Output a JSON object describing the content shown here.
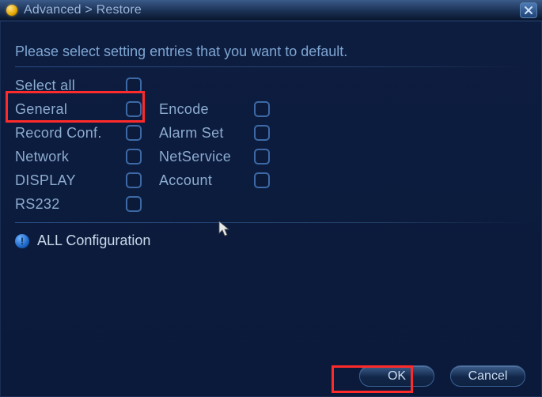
{
  "titlebar": {
    "breadcrumb": "Advanced > Restore"
  },
  "instruction": "Please select setting entries that you want to default.",
  "selectAll": {
    "label": "Select all"
  },
  "options": {
    "col1": [
      {
        "label": "General"
      },
      {
        "label": "Record Conf."
      },
      {
        "label": "Network"
      },
      {
        "label": "DISPLAY"
      },
      {
        "label": "RS232"
      }
    ],
    "col2": [
      {
        "label": "Encode"
      },
      {
        "label": "Alarm Set"
      },
      {
        "label": "NetService"
      },
      {
        "label": "Account"
      }
    ]
  },
  "info": {
    "text": "ALL Configuration"
  },
  "buttons": {
    "ok": "OK",
    "cancel": "Cancel"
  }
}
